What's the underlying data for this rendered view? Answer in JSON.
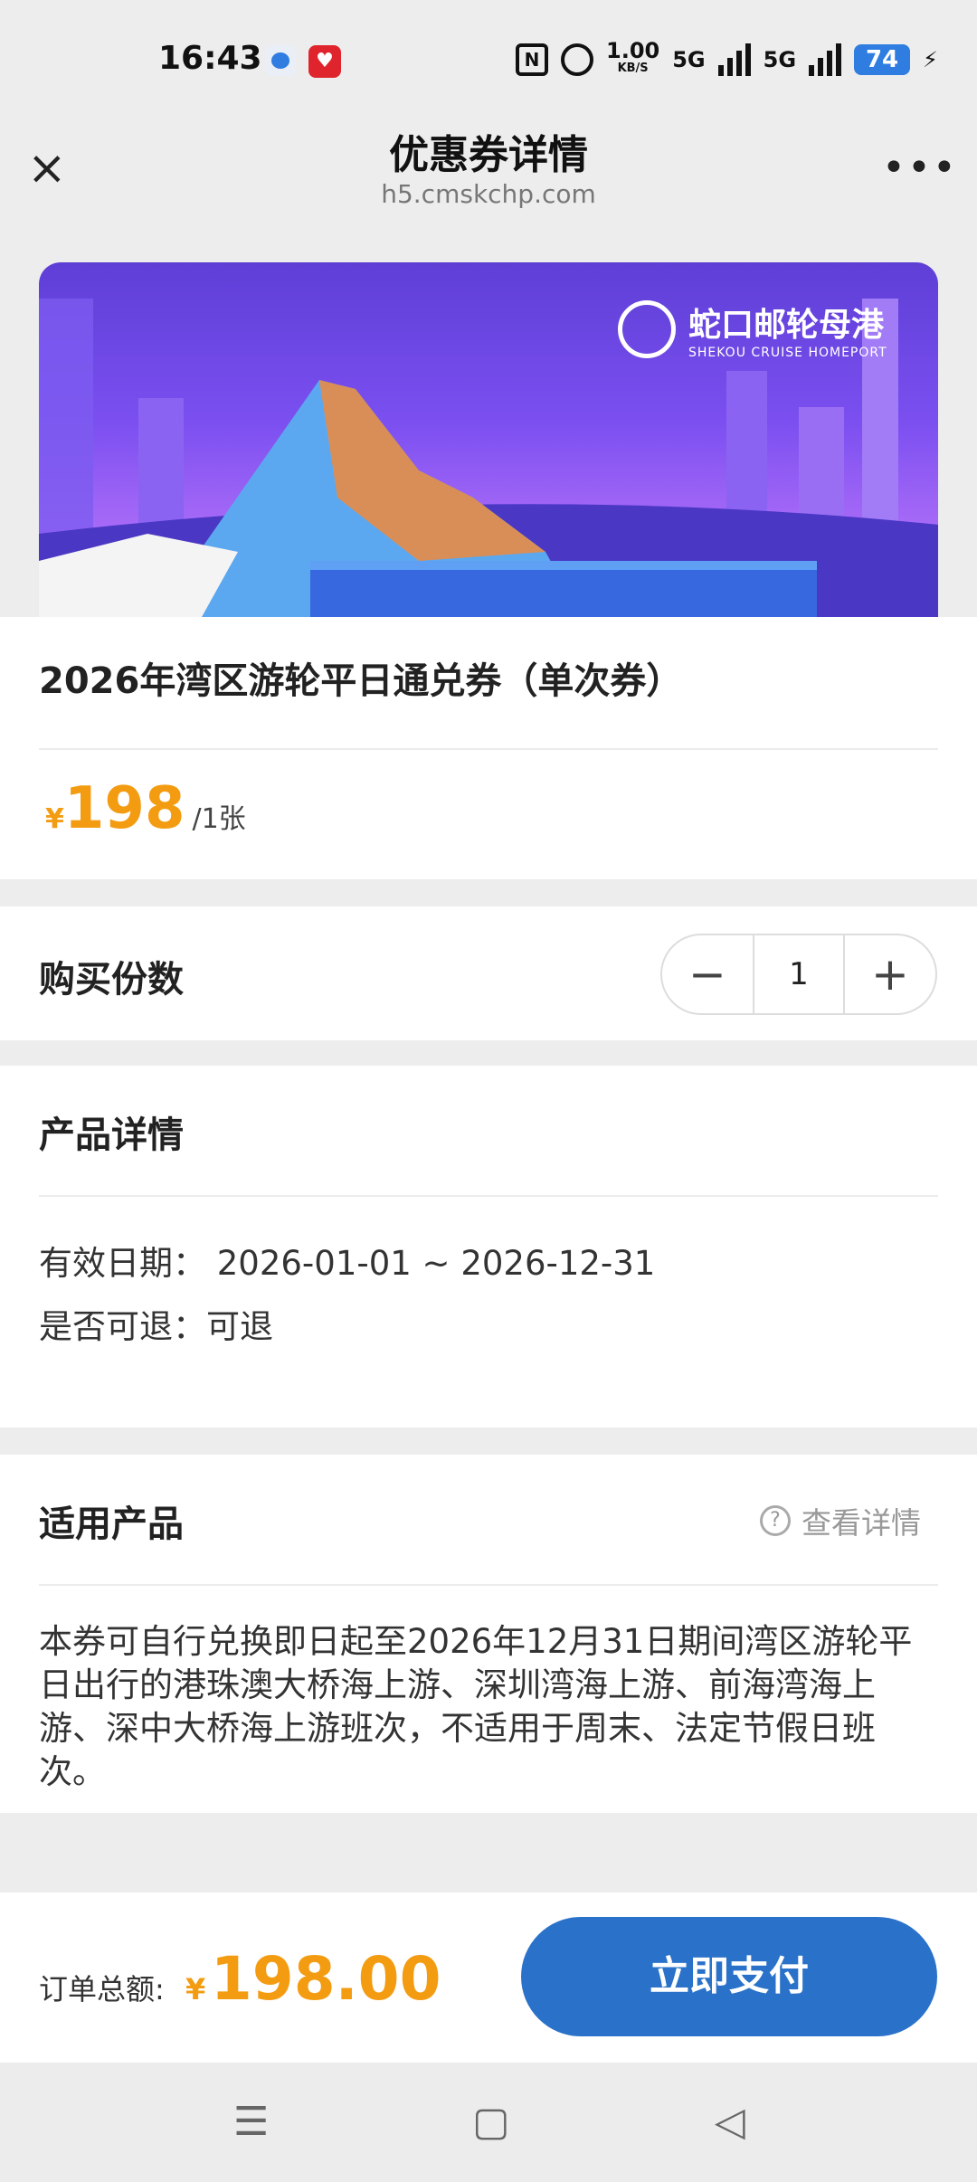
{
  "status_bar": {
    "time": "16:43",
    "speed": "1.00",
    "speed_unit": "KB/S",
    "net1": "5G",
    "net2": "5G",
    "battery": "74",
    "nfc": "N",
    "app2": "♥"
  },
  "header": {
    "close_icon": "×",
    "title": "优惠券详情",
    "subtitle": "h5.cmskchp.com",
    "more_icon": "•••"
  },
  "banner": {
    "logo_cn": "蛇口邮轮母港",
    "logo_en": "SHEKOU CRUISE HOMEPORT"
  },
  "product": {
    "title": "2026年湾区游轮平日通兑券（单次券）",
    "currency": "¥",
    "price": "198",
    "unit": "/1张"
  },
  "quantity": {
    "label": "购买份数",
    "minus": "−",
    "value": "1",
    "plus": "+"
  },
  "details": {
    "heading": "产品详情",
    "valid_label": "有效日期：",
    "valid_value": "2026-01-01 ~ 2026-12-31",
    "refund_label": "是否可退：",
    "refund_value": "可退"
  },
  "applicable": {
    "heading": "适用产品",
    "help_icon": "?",
    "help_label": "查看详情",
    "description": "本券可自行兑换即日起至2026年12月31日期间湾区游轮平日出行的港珠澳大桥海上游、深圳湾海上游、前海湾海上游、深中大桥海上游班次，不适用于周末、法定节假日班次。"
  },
  "footer": {
    "total_label": "订单总额:",
    "currency": "¥",
    "total": "198.00",
    "pay_label": "立即支付"
  },
  "nav": {
    "menu": "☰",
    "home": "▢",
    "back": "◁"
  },
  "colors": {
    "accent": "#f39c12",
    "pay": "#2a72c9",
    "banner_top": "#5e3fd6"
  }
}
